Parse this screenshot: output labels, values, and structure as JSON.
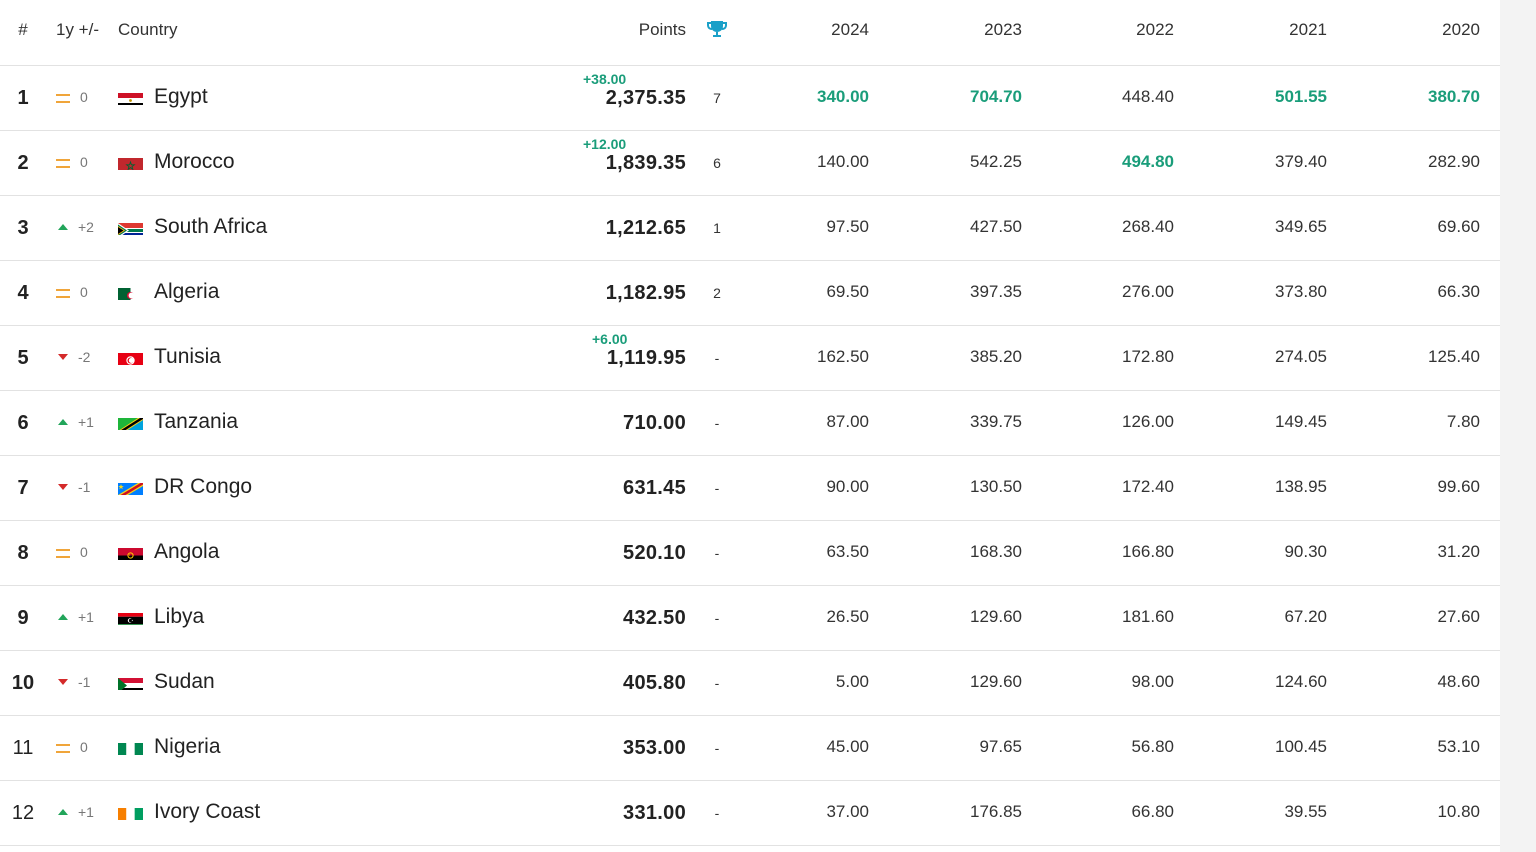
{
  "headers": {
    "rank": "#",
    "change": "1y +/-",
    "country": "Country",
    "points": "Points",
    "trophy_icon": "trophy-icon",
    "y2024": "2024",
    "y2023": "2023",
    "y2022": "2022",
    "y2021": "2021",
    "y2020": "2020"
  },
  "colors": {
    "accent_green": "#1a9d7a",
    "up": "#22a55a",
    "down": "#d42a2a",
    "equal": "#f0a53a",
    "trophy": "#1aa0c8"
  },
  "rows": [
    {
      "rank": "1",
      "change": "0",
      "dir": "eq",
      "country": "Egypt",
      "flag": "egypt",
      "points": "2,375.35",
      "bonus": "+38.00",
      "trophies": "7",
      "y2024": "340.00",
      "y2023": "704.70",
      "y2022": "448.40",
      "y2021": "501.55",
      "y2020": "380.70",
      "hl": [
        1,
        1,
        0,
        1,
        1
      ]
    },
    {
      "rank": "2",
      "change": "0",
      "dir": "eq",
      "country": "Morocco",
      "flag": "morocco",
      "points": "1,839.35",
      "bonus": "+12.00",
      "trophies": "6",
      "y2024": "140.00",
      "y2023": "542.25",
      "y2022": "494.80",
      "y2021": "379.40",
      "y2020": "282.90",
      "hl": [
        0,
        0,
        1,
        0,
        0
      ]
    },
    {
      "rank": "3",
      "change": "+2",
      "dir": "up",
      "country": "South Africa",
      "flag": "southafrica",
      "points": "1,212.65",
      "bonus": "",
      "trophies": "1",
      "y2024": "97.50",
      "y2023": "427.50",
      "y2022": "268.40",
      "y2021": "349.65",
      "y2020": "69.60",
      "hl": [
        0,
        0,
        0,
        0,
        0
      ]
    },
    {
      "rank": "4",
      "change": "0",
      "dir": "eq",
      "country": "Algeria",
      "flag": "algeria",
      "points": "1,182.95",
      "bonus": "",
      "trophies": "2",
      "y2024": "69.50",
      "y2023": "397.35",
      "y2022": "276.00",
      "y2021": "373.80",
      "y2020": "66.30",
      "hl": [
        0,
        0,
        0,
        0,
        0
      ]
    },
    {
      "rank": "5",
      "change": "-2",
      "dir": "down",
      "country": "Tunisia",
      "flag": "tunisia",
      "points": "1,119.95",
      "bonus": "+6.00",
      "trophies": "-",
      "y2024": "162.50",
      "y2023": "385.20",
      "y2022": "172.80",
      "y2021": "274.05",
      "y2020": "125.40",
      "hl": [
        0,
        0,
        0,
        0,
        0
      ]
    },
    {
      "rank": "6",
      "change": "+1",
      "dir": "up",
      "country": "Tanzania",
      "flag": "tanzania",
      "points": "710.00",
      "bonus": "",
      "trophies": "-",
      "y2024": "87.00",
      "y2023": "339.75",
      "y2022": "126.00",
      "y2021": "149.45",
      "y2020": "7.80",
      "hl": [
        0,
        0,
        0,
        0,
        0
      ]
    },
    {
      "rank": "7",
      "change": "-1",
      "dir": "down",
      "country": "DR Congo",
      "flag": "drcongo",
      "points": "631.45",
      "bonus": "",
      "trophies": "-",
      "y2024": "90.00",
      "y2023": "130.50",
      "y2022": "172.40",
      "y2021": "138.95",
      "y2020": "99.60",
      "hl": [
        0,
        0,
        0,
        0,
        0
      ]
    },
    {
      "rank": "8",
      "change": "0",
      "dir": "eq",
      "country": "Angola",
      "flag": "angola",
      "points": "520.10",
      "bonus": "",
      "trophies": "-",
      "y2024": "63.50",
      "y2023": "168.30",
      "y2022": "166.80",
      "y2021": "90.30",
      "y2020": "31.20",
      "hl": [
        0,
        0,
        0,
        0,
        0
      ]
    },
    {
      "rank": "9",
      "change": "+1",
      "dir": "up",
      "country": "Libya",
      "flag": "libya",
      "points": "432.50",
      "bonus": "",
      "trophies": "-",
      "y2024": "26.50",
      "y2023": "129.60",
      "y2022": "181.60",
      "y2021": "67.20",
      "y2020": "27.60",
      "hl": [
        0,
        0,
        0,
        0,
        0
      ]
    },
    {
      "rank": "10",
      "change": "-1",
      "dir": "down",
      "country": "Sudan",
      "flag": "sudan",
      "points": "405.80",
      "bonus": "",
      "trophies": "-",
      "y2024": "5.00",
      "y2023": "129.60",
      "y2022": "98.00",
      "y2021": "124.60",
      "y2020": "48.60",
      "hl": [
        0,
        0,
        0,
        0,
        0
      ]
    },
    {
      "rank": "11",
      "change": "0",
      "dir": "eq",
      "country": "Nigeria",
      "flag": "nigeria",
      "points": "353.00",
      "bonus": "",
      "trophies": "-",
      "y2024": "45.00",
      "y2023": "97.65",
      "y2022": "56.80",
      "y2021": "100.45",
      "y2020": "53.10",
      "hl": [
        0,
        0,
        0,
        0,
        0
      ]
    },
    {
      "rank": "12",
      "change": "+1",
      "dir": "up",
      "country": "Ivory Coast",
      "flag": "ivorycoast",
      "points": "331.00",
      "bonus": "",
      "trophies": "-",
      "y2024": "37.00",
      "y2023": "176.85",
      "y2022": "66.80",
      "y2021": "39.55",
      "y2020": "10.80",
      "hl": [
        0,
        0,
        0,
        0,
        0
      ]
    }
  ]
}
